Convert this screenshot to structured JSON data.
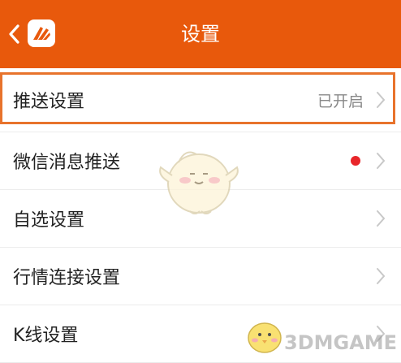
{
  "header": {
    "title": "设置",
    "back_icon": "chevron-left-icon",
    "logo_icon": "app-logo-icon",
    "background": "#e8590c"
  },
  "settings": {
    "items": [
      {
        "label": "推送设置",
        "value": "已开启",
        "highlighted": true
      },
      {
        "label": "微信消息推送",
        "badge": "red-dot",
        "badge_color": "#e8262a"
      },
      {
        "label": "自选设置"
      },
      {
        "label": "行情连接设置"
      },
      {
        "label": "K线设置"
      }
    ]
  },
  "watermark": {
    "text": "3DMGAME"
  },
  "colors": {
    "accent": "#e8590c",
    "highlight_border": "#e8732c",
    "chevron": "#c8c8c8"
  }
}
